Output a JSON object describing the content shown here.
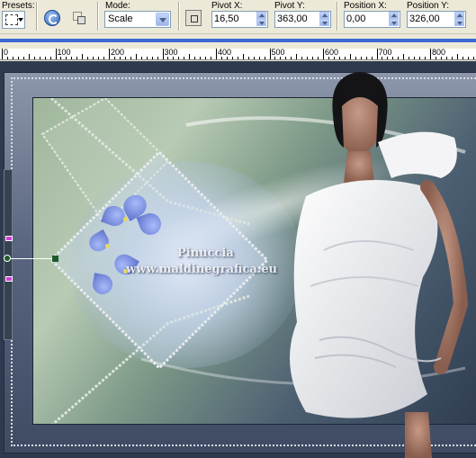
{
  "toolbar": {
    "presets_label": "Presets:",
    "mode_label": "Mode:",
    "mode_value": "Scale",
    "pivot_x_label": "Pivot X:",
    "pivot_x_value": "16,50",
    "pivot_y_label": "Pivot Y:",
    "pivot_y_value": "363,00",
    "position_x_label": "Position X:",
    "position_x_value": "0,00",
    "position_y_label": "Position Y:",
    "position_y_value": "326,00"
  },
  "ruler": {
    "labels": [
      "0",
      "100",
      "200",
      "300",
      "400",
      "500",
      "600",
      "700",
      "800"
    ]
  },
  "canvas": {
    "watermark_line1": "Pinuccia",
    "watermark_line2": "www.maldinegrafica.eu"
  },
  "colors": {
    "toolbar_bg": "#ece9d8",
    "accent_blue": "#3a6ad4",
    "handle_pink": "#d040d0",
    "handle_green": "#1f5a2a"
  },
  "icons": [
    "preset-selection-icon",
    "reset-icon",
    "mode-icon",
    "pivot-icon",
    "dropdown-arrow-icon",
    "spin-up-icon",
    "spin-down-icon"
  ]
}
